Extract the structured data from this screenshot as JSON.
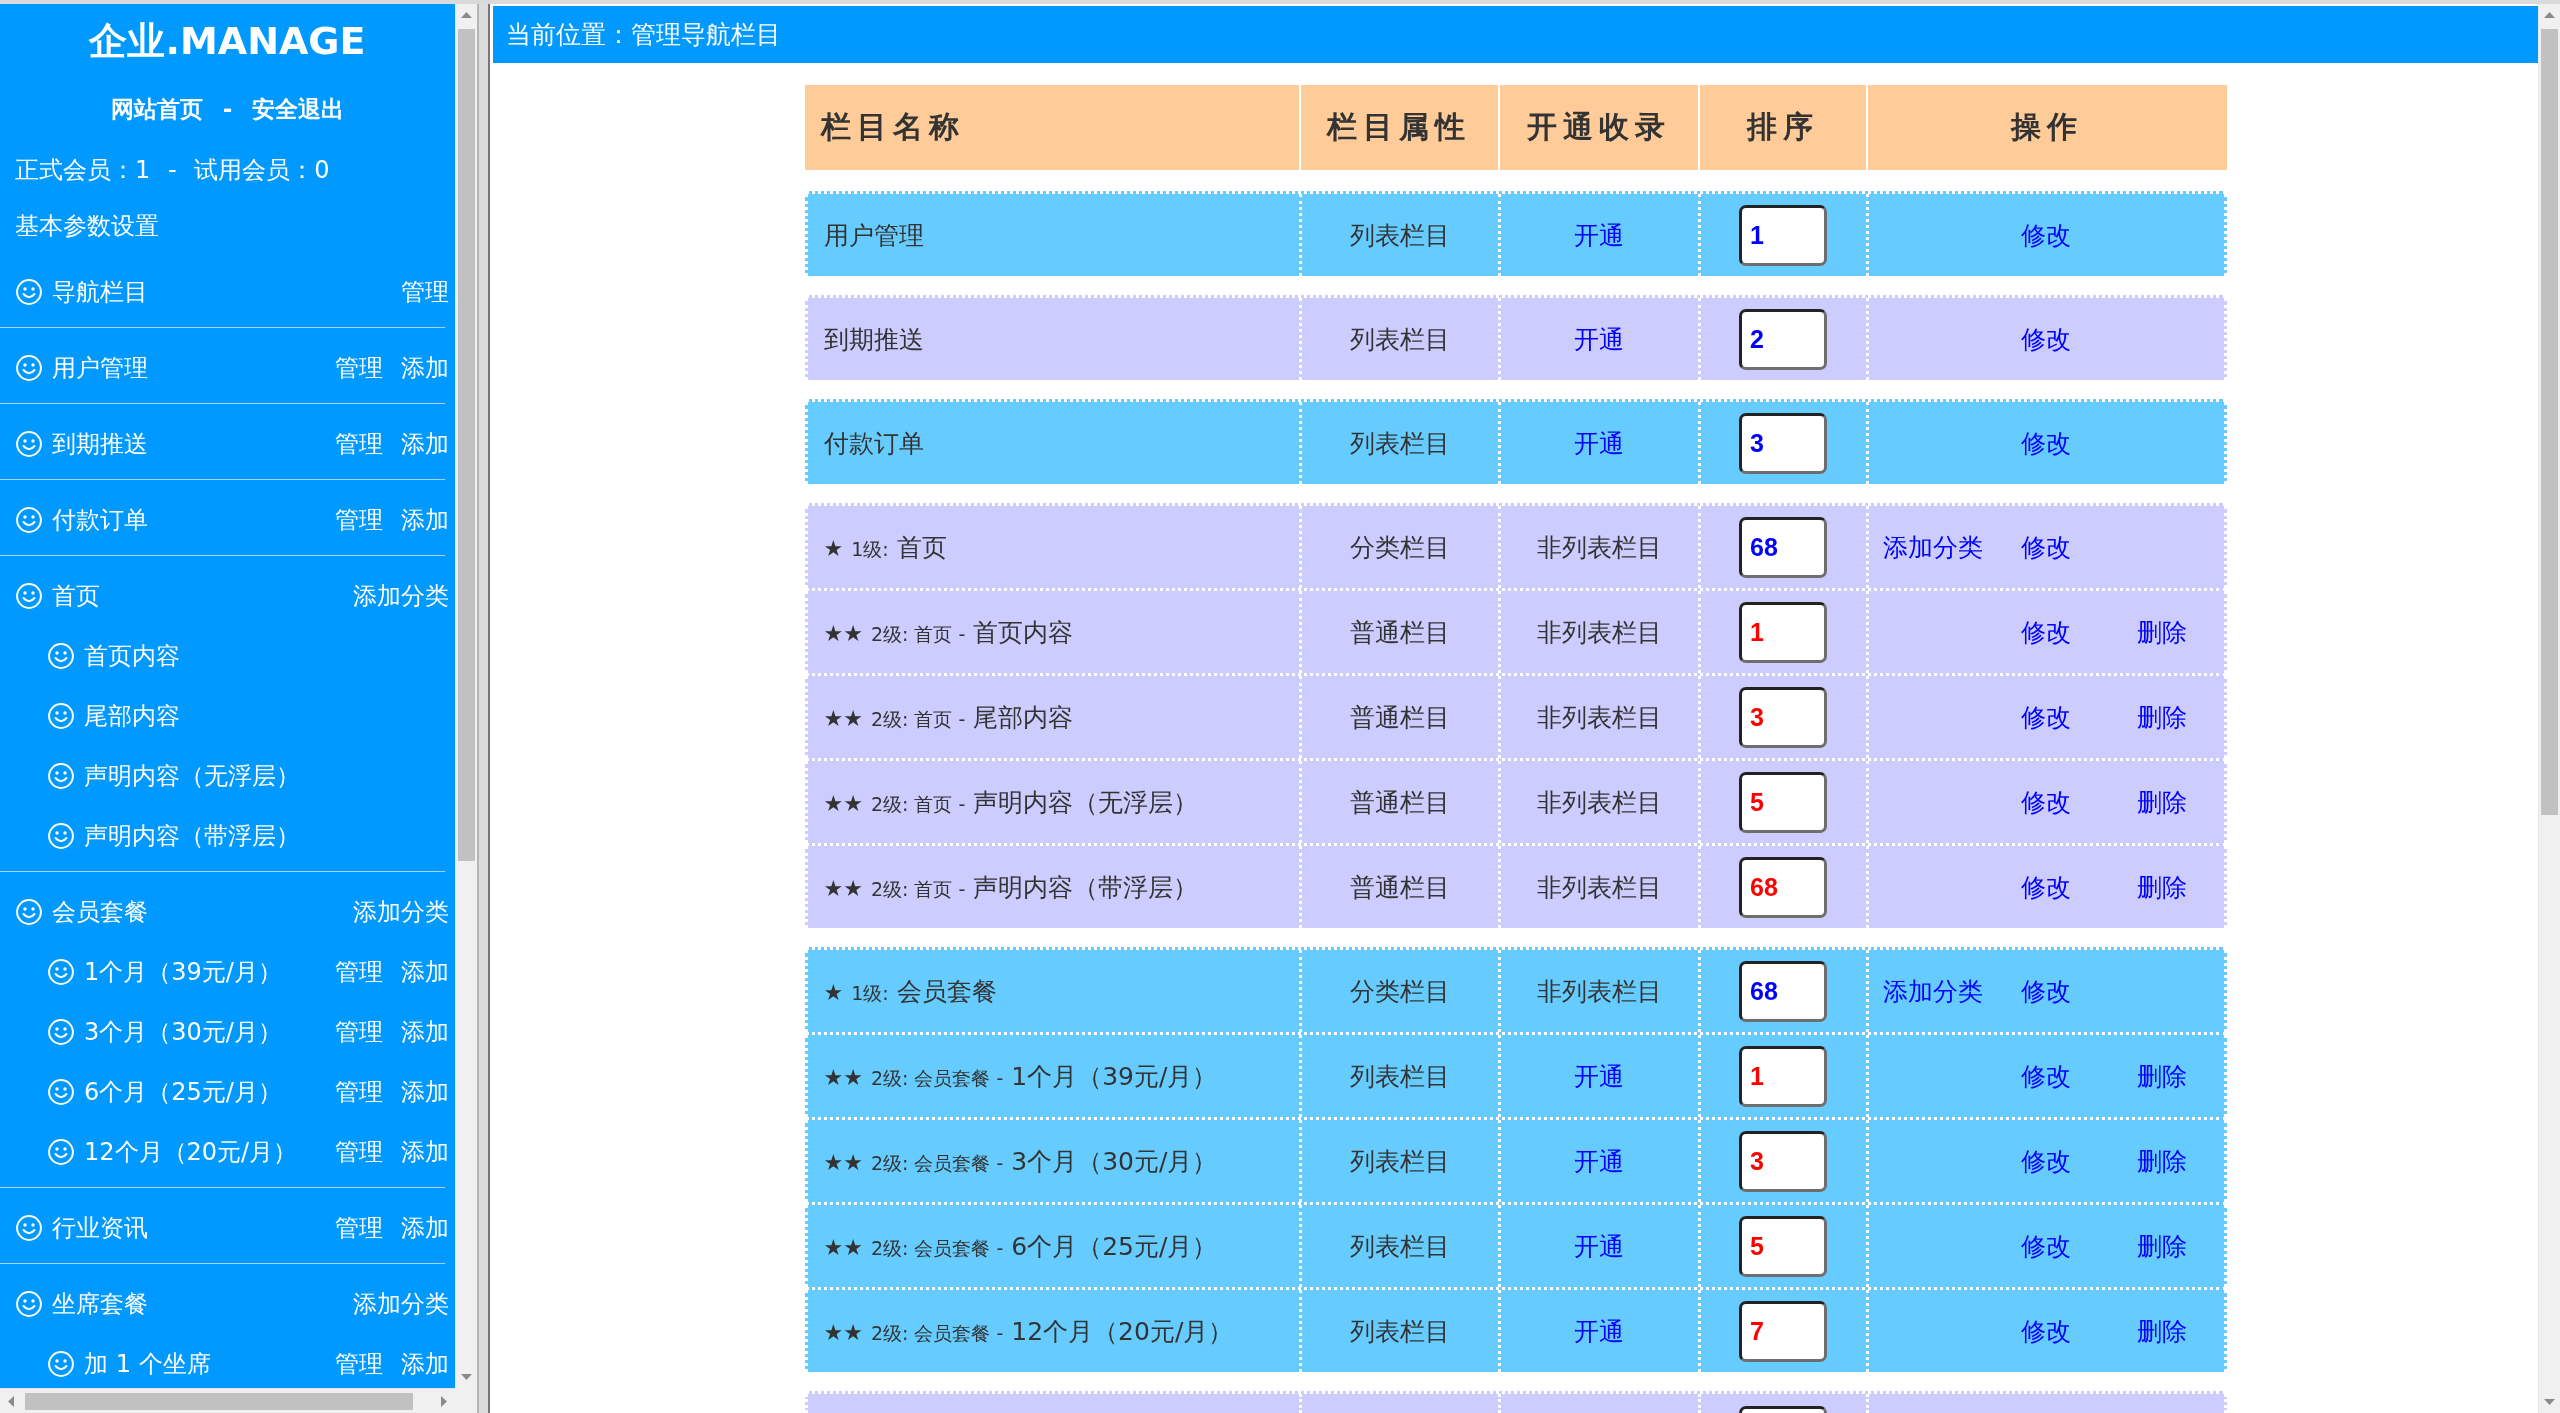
{
  "sidebar": {
    "title": "企业.MANAGE",
    "links": [
      {
        "text": "网站首页"
      },
      {
        "text": "安全退出"
      }
    ],
    "link_separator": "-",
    "stats": "正式会员：1 - 试用会员：0",
    "settings_link": "基本参数设置",
    "items": [
      {
        "label": "导航栏目",
        "actions": [
          "管理"
        ]
      },
      {
        "label": "用户管理",
        "actions": [
          "管理",
          "添加"
        ]
      },
      {
        "label": "到期推送",
        "actions": [
          "管理",
          "添加"
        ]
      },
      {
        "label": "付款订单",
        "actions": [
          "管理",
          "添加"
        ]
      },
      {
        "label": "首页",
        "actions": [
          "添加分类"
        ],
        "children": [
          {
            "label": "首页内容"
          },
          {
            "label": "尾部内容"
          },
          {
            "label": "声明内容（无浮层）"
          },
          {
            "label": "声明内容（带浮层）"
          }
        ]
      },
      {
        "label": "会员套餐",
        "actions": [
          "添加分类"
        ],
        "children": [
          {
            "label": "1个月（39元/月）",
            "actions": [
              "管理",
              "添加"
            ]
          },
          {
            "label": "3个月（30元/月）",
            "actions": [
              "管理",
              "添加"
            ]
          },
          {
            "label": "6个月（25元/月）",
            "actions": [
              "管理",
              "添加"
            ]
          },
          {
            "label": "12个月（20元/月）",
            "actions": [
              "管理",
              "添加"
            ]
          }
        ]
      },
      {
        "label": "行业资讯",
        "actions": [
          "管理",
          "添加"
        ]
      },
      {
        "label": "坐席套餐",
        "actions": [
          "添加分类"
        ],
        "children": [
          {
            "label": "加 1 个坐席",
            "actions": [
              "管理",
              "添加"
            ]
          }
        ]
      }
    ]
  },
  "breadcrumb": "当前位置：管理导航栏目",
  "table": {
    "columns": [
      "栏目名称",
      "栏目属性",
      "开通收录",
      "排序",
      "操作"
    ],
    "groups": [
      {
        "color": "#66ccff",
        "rows": [
          {
            "kind": "plain",
            "title": "用户管理",
            "attribute": "列表栏目",
            "indexing": {
              "kind": "link",
              "text": "开通"
            },
            "order": "1",
            "actions": [
              {
                "kind": "edit",
                "text": "修改"
              }
            ]
          }
        ]
      },
      {
        "color": "#ccccff",
        "rows": [
          {
            "kind": "plain",
            "title": "到期推送",
            "attribute": "列表栏目",
            "indexing": {
              "kind": "link",
              "text": "开通"
            },
            "order": "2",
            "actions": [
              {
                "kind": "edit",
                "text": "修改"
              }
            ]
          }
        ]
      },
      {
        "color": "#66ccff",
        "rows": [
          {
            "kind": "plain",
            "title": "付款订单",
            "attribute": "列表栏目",
            "indexing": {
              "kind": "link",
              "text": "开通"
            },
            "order": "3",
            "actions": [
              {
                "kind": "edit",
                "text": "修改"
              }
            ]
          }
        ]
      },
      {
        "color": "#ccccff",
        "rows": [
          {
            "kind": "category",
            "stars": "★",
            "level": "1级:",
            "title": "首页",
            "attribute": "分类栏目",
            "indexing": {
              "kind": "text",
              "text": "非列表栏目"
            },
            "order": "68",
            "actions": [
              {
                "kind": "add",
                "text": "添加分类"
              },
              {
                "kind": "edit",
                "text": "修改"
              }
            ]
          },
          {
            "kind": "child",
            "stars": "★★",
            "level": "2级: 首页 -",
            "title": "首页内容",
            "attribute": "普通栏目",
            "indexing": {
              "kind": "text",
              "text": "非列表栏目"
            },
            "order": "1",
            "actions": [
              {
                "kind": "edit",
                "text": "修改"
              },
              {
                "kind": "delete",
                "text": "删除"
              }
            ]
          },
          {
            "kind": "child",
            "stars": "★★",
            "level": "2级: 首页 -",
            "title": "尾部内容",
            "attribute": "普通栏目",
            "indexing": {
              "kind": "text",
              "text": "非列表栏目"
            },
            "order": "3",
            "actions": [
              {
                "kind": "edit",
                "text": "修改"
              },
              {
                "kind": "delete",
                "text": "删除"
              }
            ]
          },
          {
            "kind": "child",
            "stars": "★★",
            "level": "2级: 首页 -",
            "title": "声明内容（无浮层）",
            "attribute": "普通栏目",
            "indexing": {
              "kind": "text",
              "text": "非列表栏目"
            },
            "order": "5",
            "actions": [
              {
                "kind": "edit",
                "text": "修改"
              },
              {
                "kind": "delete",
                "text": "删除"
              }
            ]
          },
          {
            "kind": "child",
            "stars": "★★",
            "level": "2级: 首页 -",
            "title": "声明内容（带浮层）",
            "attribute": "普通栏目",
            "indexing": {
              "kind": "text",
              "text": "非列表栏目"
            },
            "order": "68",
            "actions": [
              {
                "kind": "edit",
                "text": "修改"
              },
              {
                "kind": "delete",
                "text": "删除"
              }
            ]
          }
        ]
      },
      {
        "color": "#66ccff",
        "rows": [
          {
            "kind": "category",
            "stars": "★",
            "level": "1级:",
            "title": "会员套餐",
            "attribute": "分类栏目",
            "indexing": {
              "kind": "text",
              "text": "非列表栏目"
            },
            "order": "68",
            "actions": [
              {
                "kind": "add",
                "text": "添加分类"
              },
              {
                "kind": "edit",
                "text": "修改"
              }
            ]
          },
          {
            "kind": "child",
            "stars": "★★",
            "level": "2级: 会员套餐 -",
            "title": "1个月（39元/月）",
            "attribute": "列表栏目",
            "indexing": {
              "kind": "link",
              "text": "开通"
            },
            "order": "1",
            "actions": [
              {
                "kind": "edit",
                "text": "修改"
              },
              {
                "kind": "delete",
                "text": "删除"
              }
            ]
          },
          {
            "kind": "child",
            "stars": "★★",
            "level": "2级: 会员套餐 -",
            "title": "3个月（30元/月）",
            "attribute": "列表栏目",
            "indexing": {
              "kind": "link",
              "text": "开通"
            },
            "order": "3",
            "actions": [
              {
                "kind": "edit",
                "text": "修改"
              },
              {
                "kind": "delete",
                "text": "删除"
              }
            ]
          },
          {
            "kind": "child",
            "stars": "★★",
            "level": "2级: 会员套餐 -",
            "title": "6个月（25元/月）",
            "attribute": "列表栏目",
            "indexing": {
              "kind": "link",
              "text": "开通"
            },
            "order": "5",
            "actions": [
              {
                "kind": "edit",
                "text": "修改"
              },
              {
                "kind": "delete",
                "text": "删除"
              }
            ]
          },
          {
            "kind": "child",
            "stars": "★★",
            "level": "2级: 会员套餐 -",
            "title": "12个月（20元/月）",
            "attribute": "列表栏目",
            "indexing": {
              "kind": "link",
              "text": "开通"
            },
            "order": "7",
            "actions": [
              {
                "kind": "edit",
                "text": "修改"
              },
              {
                "kind": "delete",
                "text": "删除"
              }
            ]
          }
        ]
      },
      {
        "color": "#ccccff"
      }
    ]
  }
}
